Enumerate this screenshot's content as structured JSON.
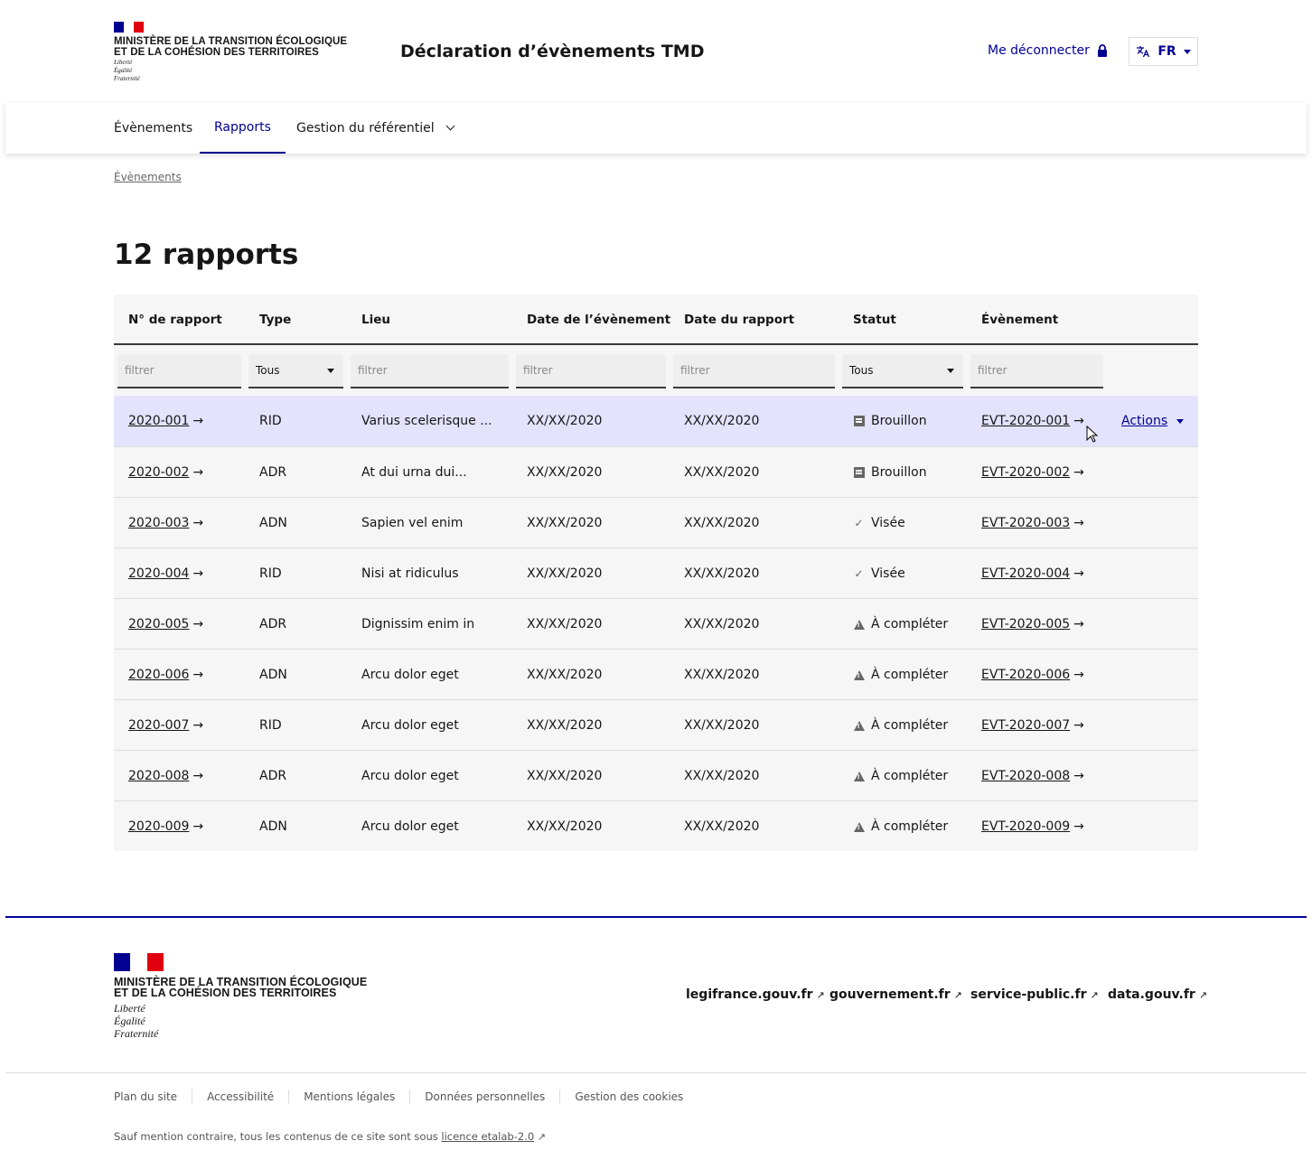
{
  "header": {
    "ministry_line1": "MINISTÈRE DE LA TRANSITION ÉCOLOGIQUE",
    "ministry_line2": "ET DE LA COHÉSION DES TERRITOIRES",
    "devise1": "Liberté",
    "devise2": "Égalité",
    "devise3": "Fraternité",
    "site_title": "Déclaration d’évènements TMD",
    "logout_label": "Me déconnecter",
    "lang_label": "FR"
  },
  "nav": {
    "items": [
      {
        "label": "Évènements"
      },
      {
        "label": "Rapports"
      },
      {
        "label": "Gestion du référentiel"
      }
    ]
  },
  "breadcrumb": "Évènements",
  "page_title": "12 rapports",
  "table": {
    "headers": [
      "N° de rapport",
      "Type",
      "Lieu",
      "Date de l’évènement",
      "Date du rapport",
      "Statut",
      "Évènement"
    ],
    "filters": {
      "placeholder": "filtrer",
      "type_select": "Tous",
      "status_select": "Tous"
    },
    "actions_label": "Actions",
    "rows": [
      {
        "num": "2020-001",
        "type": "RID",
        "lieu": "Varius scelerisque ...",
        "date_evt": "XX/XX/2020",
        "date_rap": "XX/XX/2020",
        "statut": "Brouillon",
        "status_icon": "draft-icon",
        "evt": "EVT-2020-001"
      },
      {
        "num": "2020-002",
        "type": "ADR",
        "lieu": "At dui urna dui...",
        "date_evt": "XX/XX/2020",
        "date_rap": "XX/XX/2020",
        "statut": "Brouillon",
        "status_icon": "draft-icon",
        "evt": "EVT-2020-002"
      },
      {
        "num": "2020-003",
        "type": "ADN",
        "lieu": "Sapien vel enim",
        "date_evt": "XX/XX/2020",
        "date_rap": "XX/XX/2020",
        "statut": "Visée",
        "status_icon": "check-icon",
        "evt": "EVT-2020-003"
      },
      {
        "num": "2020-004",
        "type": "RID",
        "lieu": "Nisi at ridiculus",
        "date_evt": "XX/XX/2020",
        "date_rap": "XX/XX/2020",
        "statut": "Visée",
        "status_icon": "check-icon",
        "evt": "EVT-2020-004"
      },
      {
        "num": "2020-005",
        "type": "ADR",
        "lieu": "Dignissim enim in",
        "date_evt": "XX/XX/2020",
        "date_rap": "XX/XX/2020",
        "statut": "À compléter",
        "status_icon": "warning-icon",
        "evt": "EVT-2020-005"
      },
      {
        "num": "2020-006",
        "type": "ADN",
        "lieu": "Arcu dolor eget",
        "date_evt": "XX/XX/2020",
        "date_rap": "XX/XX/2020",
        "statut": "À compléter",
        "status_icon": "warning-icon",
        "evt": "EVT-2020-006"
      },
      {
        "num": "2020-007",
        "type": "RID",
        "lieu": "Arcu dolor eget",
        "date_evt": "XX/XX/2020",
        "date_rap": "XX/XX/2020",
        "statut": "À compléter",
        "status_icon": "warning-icon",
        "evt": "EVT-2020-007"
      },
      {
        "num": "2020-008",
        "type": "ADR",
        "lieu": "Arcu dolor eget",
        "date_evt": "XX/XX/2020",
        "date_rap": "XX/XX/2020",
        "statut": "À compléter",
        "status_icon": "warning-icon",
        "evt": "EVT-2020-008"
      },
      {
        "num": "2020-009",
        "type": "ADN",
        "lieu": "Arcu dolor eget",
        "date_evt": "XX/XX/2020",
        "date_rap": "XX/XX/2020",
        "statut": "À compléter",
        "status_icon": "warning-icon",
        "evt": "EVT-2020-009"
      }
    ]
  },
  "footer": {
    "links": [
      "legifrance.gouv.fr",
      "gouvernement.fr",
      "service-public.fr",
      "data.gouv.fr"
    ],
    "bottom_links": [
      "Plan du site",
      "Accessibilité",
      "Mentions légales",
      "Données personnelles",
      "Gestion des cookies"
    ],
    "license_text": "Sauf mention contraire, tous les contenus de ce site sont sous",
    "license_link": "licence etalab-2.0"
  },
  "colors": {
    "brand_blue": "#000091",
    "brand_red": "#e1000f",
    "row_highlight": "#e3e3fd",
    "table_bg": "#f6f6f6"
  }
}
